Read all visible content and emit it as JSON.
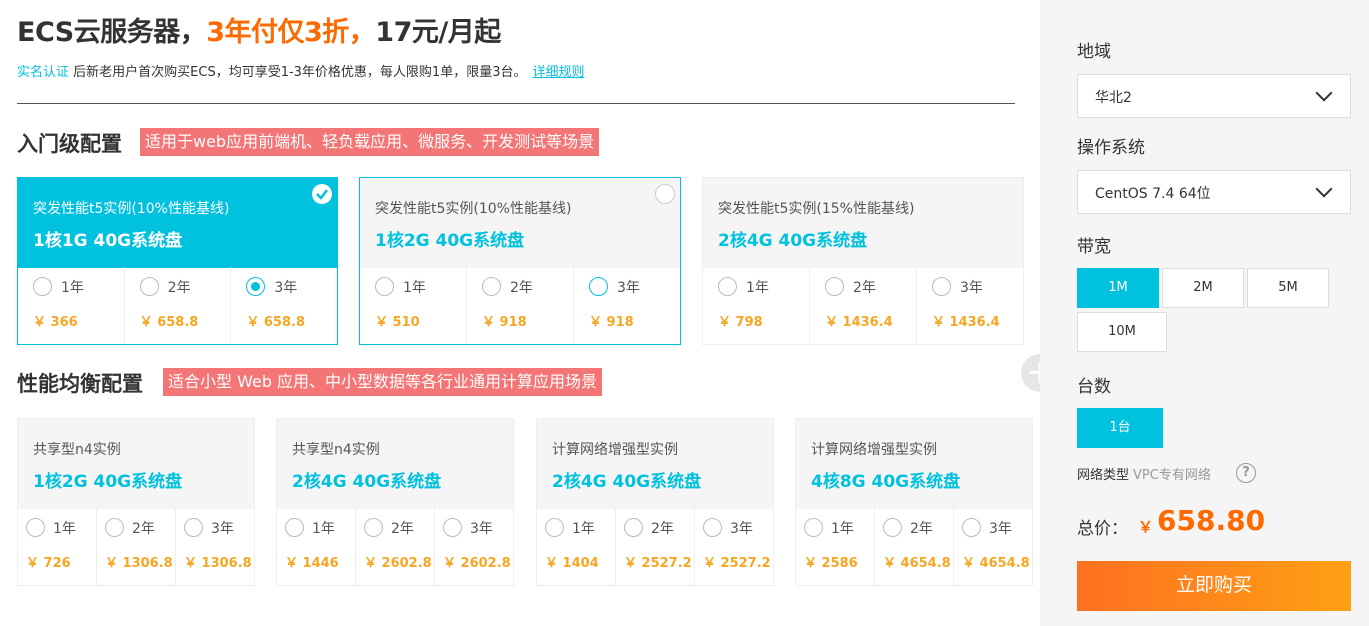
{
  "header": {
    "headline_a": "ECS云服务器，",
    "headline_b": "3年付仅3折，",
    "headline_c": "17元/月起",
    "sub_verify": "实名认证",
    "sub_text": " 后新老用户首次购买ECS，均可享受1-3年价格优惠，每人限购1单，限量3台。",
    "sub_rules": "详细规则"
  },
  "entry": {
    "title": "入门级配置",
    "tag": "适用于web应用前端机、轻负载应用、微服务、开发测试等场景",
    "cards": [
      {
        "type": "突发性能t5实例(10%性能基线)",
        "spec": "1核1G 40G系统盘",
        "selected": true,
        "options": [
          {
            "year": "1年",
            "price": "￥ 366"
          },
          {
            "year": "2年",
            "price": "￥ 658.8"
          },
          {
            "year": "3年",
            "price": "￥ 658.8"
          }
        ]
      },
      {
        "type": "突发性能t5实例(10%性能基线)",
        "spec": "1核2G 40G系统盘",
        "selected": false,
        "options": [
          {
            "year": "1年",
            "price": "￥ 510"
          },
          {
            "year": "2年",
            "price": "￥ 918"
          },
          {
            "year": "3年",
            "price": "￥ 918"
          }
        ]
      },
      {
        "type": "突发性能t5实例(15%性能基线)",
        "spec": "2核4G 40G系统盘",
        "selected": false,
        "options": [
          {
            "year": "1年",
            "price": "￥ 798"
          },
          {
            "year": "2年",
            "price": "￥ 1436.4"
          },
          {
            "year": "3年",
            "price": "￥ 1436.4"
          }
        ]
      }
    ]
  },
  "balanced": {
    "title": "性能均衡配置",
    "tag": "适合小型 Web 应用、中小型数据等各行业通用计算应用场景",
    "cards": [
      {
        "type": "共享型n4实例",
        "spec": "1核2G 40G系统盘",
        "options": [
          {
            "year": "1年",
            "price": "￥ 726"
          },
          {
            "year": "2年",
            "price": "￥ 1306.8"
          },
          {
            "year": "3年",
            "price": "￥ 1306.8"
          }
        ]
      },
      {
        "type": "共享型n4实例",
        "spec": "2核4G 40G系统盘",
        "options": [
          {
            "year": "1年",
            "price": "￥ 1446"
          },
          {
            "year": "2年",
            "price": "￥ 2602.8"
          },
          {
            "year": "3年",
            "price": "￥ 2602.8"
          }
        ]
      },
      {
        "type": "计算网络增强型实例",
        "spec": "2核4G 40G系统盘",
        "options": [
          {
            "year": "1年",
            "price": "￥ 1404"
          },
          {
            "year": "2年",
            "price": "￥ 2527.2"
          },
          {
            "year": "3年",
            "price": "￥ 2527.2"
          }
        ]
      },
      {
        "type": "计算网络增强型实例",
        "spec": "4核8G 40G系统盘",
        "options": [
          {
            "year": "1年",
            "price": "￥ 2586"
          },
          {
            "year": "2年",
            "price": "￥ 4654.8"
          },
          {
            "year": "3年",
            "price": "￥ 4654.8"
          }
        ]
      }
    ]
  },
  "sidebar": {
    "region_label": "地域",
    "region_value": "华北2",
    "os_label": "操作系统",
    "os_value": "CentOS 7.4 64位",
    "bandwidth_label": "带宽",
    "bandwidth_options": [
      "1M",
      "2M",
      "5M",
      "10M"
    ],
    "bandwidth_selected": "1M",
    "count_label": "台数",
    "count_value": "1台",
    "network_label": "网络类型",
    "network_value": "VPC专有网络",
    "total_label": "总价：",
    "total_currency": "￥",
    "total_value": "658.80",
    "buy_label": "立即购买"
  },
  "colors": {
    "accent": "#00c1de",
    "orange": "#ff6a00",
    "tag": "#f47575",
    "price": "#f5a623"
  }
}
